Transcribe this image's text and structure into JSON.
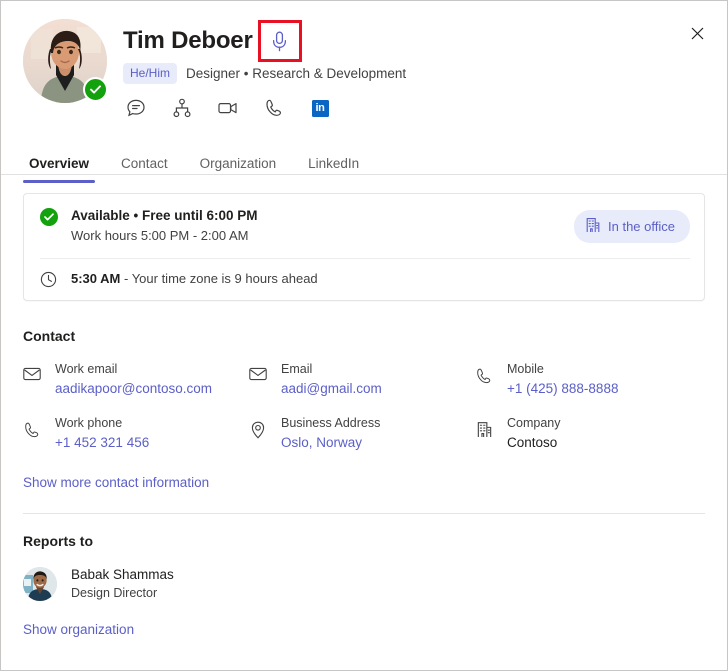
{
  "window": {
    "close_label": "Close",
    "close_icon": "close-icon"
  },
  "person": {
    "name": "Tim Deboer",
    "pronouns": "He/Him",
    "role_line": "Designer • Research & Development",
    "presence": "available",
    "avatar_alt": "Tim Deboer profile photo"
  },
  "mic": {
    "icon": "microphone-icon",
    "highlight_color": "#e81123",
    "icon_color": "#5b5fc7"
  },
  "quick_actions": [
    {
      "name": "chat-icon",
      "label": "Chat"
    },
    {
      "name": "org-chart-icon",
      "label": "Organization"
    },
    {
      "name": "video-call-icon",
      "label": "Video call"
    },
    {
      "name": "audio-call-icon",
      "label": "Audio call"
    },
    {
      "name": "linkedin-icon",
      "label": "in"
    }
  ],
  "tabs": [
    {
      "label": "Overview",
      "active": true
    },
    {
      "label": "Contact",
      "active": false
    },
    {
      "label": "Organization",
      "active": false
    },
    {
      "label": "LinkedIn",
      "active": false
    }
  ],
  "status_card": {
    "availability": "Available • Free until 6:00 PM",
    "work_hours": "Work hours 5:00 PM - 2:00 AM",
    "location_pill": {
      "label": "In the office",
      "icon": "building-icon"
    },
    "local_time": "5:30 AM",
    "timezone_note": " - Your time zone is 9 hours ahead",
    "clock_icon": "clock-icon"
  },
  "contact": {
    "heading": "Contact",
    "items": [
      {
        "icon": "mail-icon",
        "label": "Work email",
        "value": "aadikapoor@contoso.com",
        "link": true
      },
      {
        "icon": "mail-icon",
        "label": "Email",
        "value": "aadi@gmail.com",
        "link": true
      },
      {
        "icon": "phone-icon",
        "label": "Mobile",
        "value": "+1 (425) 888-8888",
        "link": true
      },
      {
        "icon": "phone-icon",
        "label": "Work phone",
        "value": "+1 452 321 456",
        "link": true
      },
      {
        "icon": "location-icon",
        "label": "Business Address",
        "value": "Oslo, Norway",
        "link": true
      },
      {
        "icon": "building-icon",
        "label": "Company",
        "value": "Contoso",
        "link": false
      }
    ],
    "show_more": "Show more contact information"
  },
  "reports_to": {
    "heading": "Reports to",
    "person": {
      "name": "Babak Shammas",
      "title": "Design Director"
    },
    "show_organization": "Show organization"
  },
  "colors": {
    "accent": "#5b5fc7",
    "accent_soft": "#e8ebfa",
    "available_green": "#13a10e",
    "highlight_red": "#e81123",
    "linkedin_blue": "#0a66c2",
    "text_primary": "#201f1e",
    "text_secondary": "#424242"
  }
}
